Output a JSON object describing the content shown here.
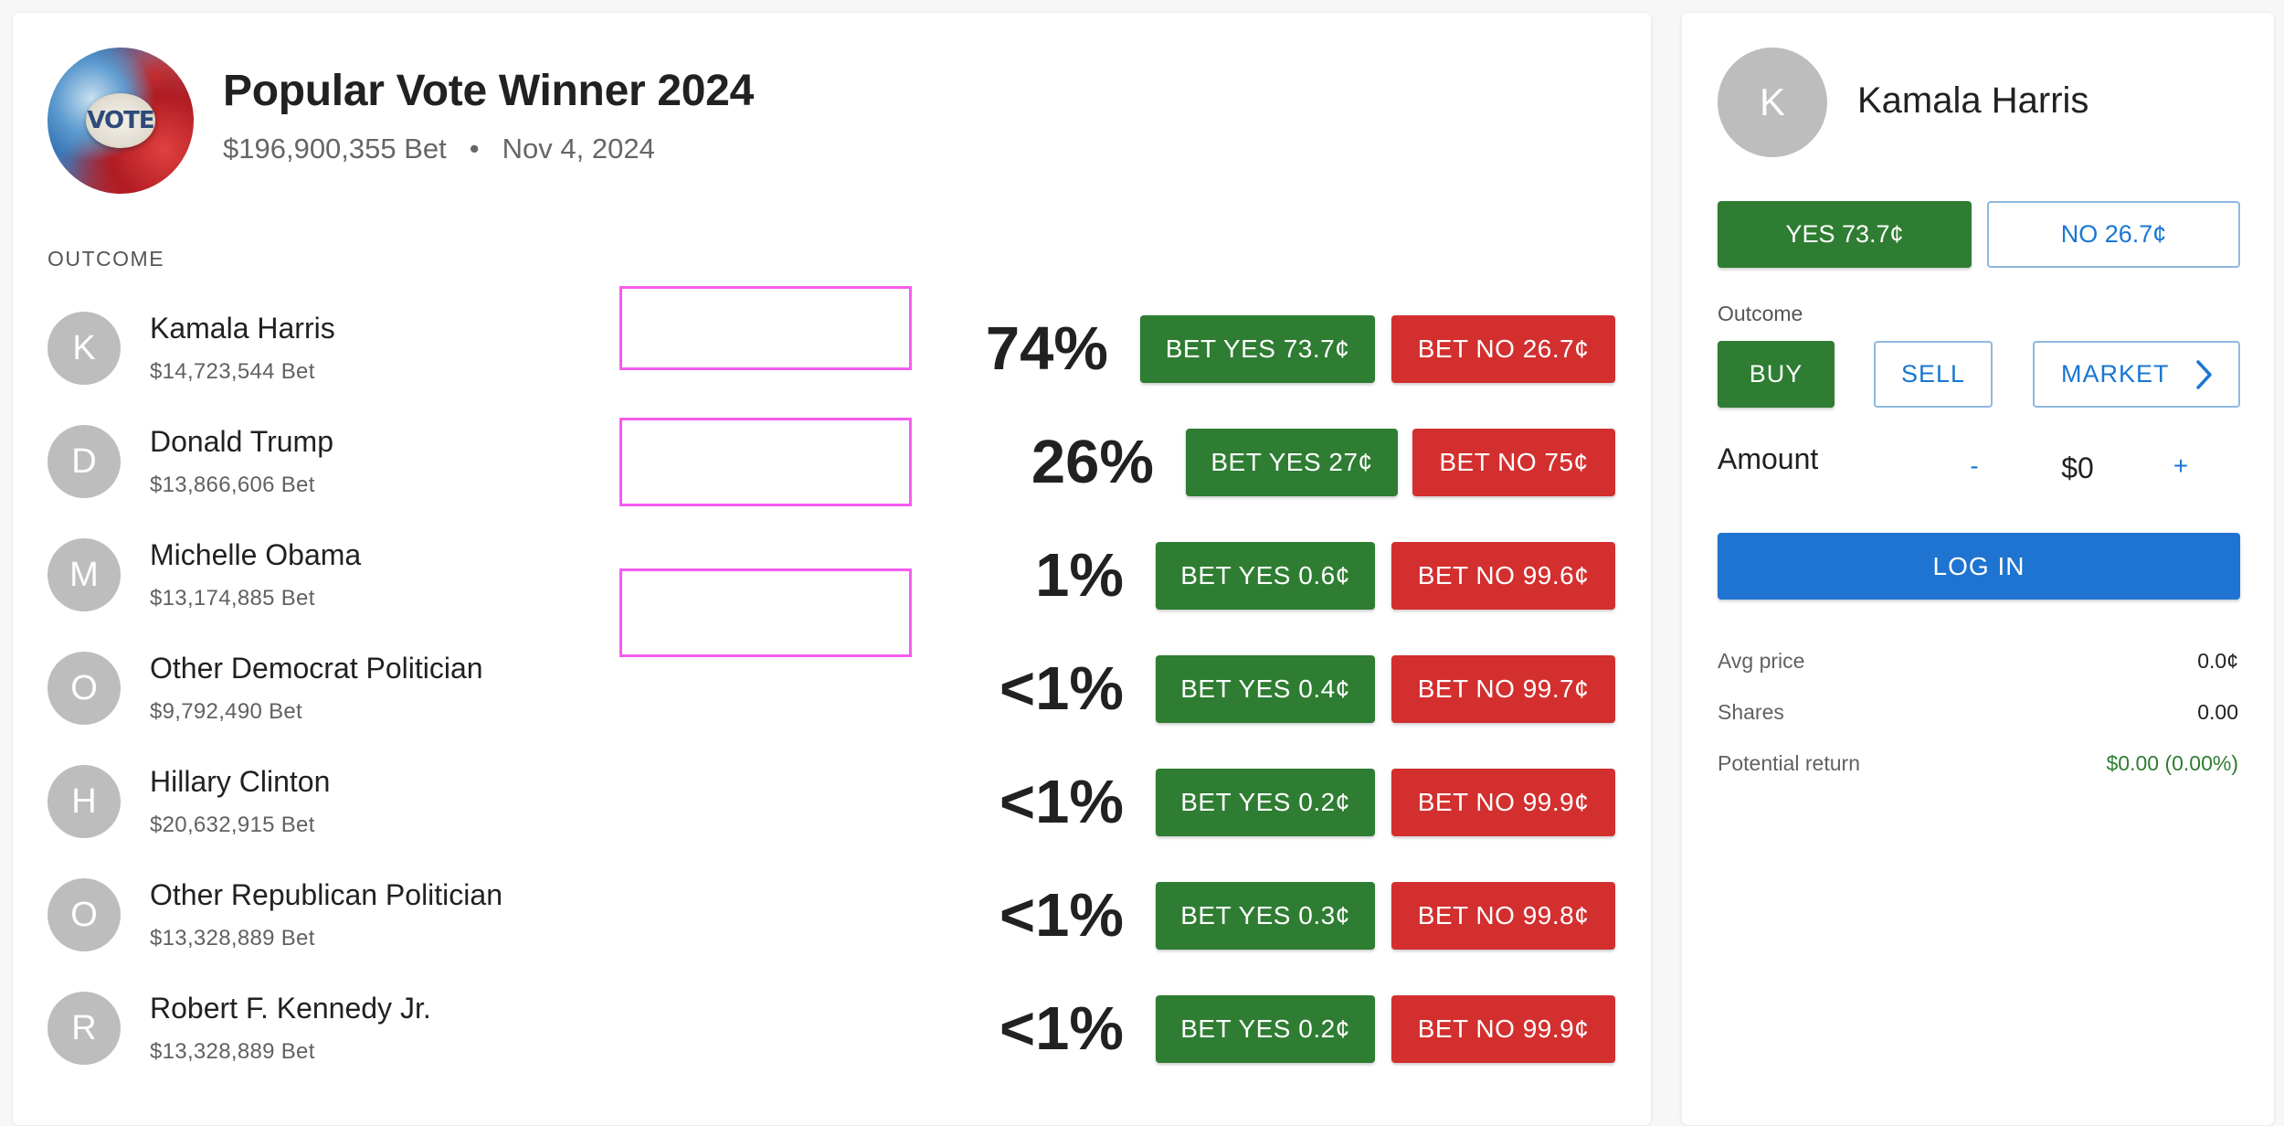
{
  "market": {
    "title": "Popular Vote Winner 2024",
    "volume": "$196,900,355 Bet",
    "separator": "•",
    "date": "Nov 4, 2024",
    "image_text": "VOTE",
    "outcome_header": "OUTCOME"
  },
  "outcomes": [
    {
      "initial": "K",
      "name": "Kamala Harris",
      "volume": "$14,723,544 Bet",
      "pct": "74%",
      "yes": "BET YES 73.7¢",
      "no": "BET NO 26.7¢"
    },
    {
      "initial": "D",
      "name": "Donald Trump",
      "volume": "$13,866,606 Bet",
      "pct": "26%",
      "yes": "BET YES 27¢",
      "no": "BET NO 75¢"
    },
    {
      "initial": "M",
      "name": "Michelle Obama",
      "volume": "$13,174,885 Bet",
      "pct": "1%",
      "yes": "BET YES 0.6¢",
      "no": "BET NO 99.6¢"
    },
    {
      "initial": "O",
      "name": "Other Democrat Politician",
      "volume": "$9,792,490 Bet",
      "pct": "<1%",
      "yes": "BET YES 0.4¢",
      "no": "BET NO 99.7¢"
    },
    {
      "initial": "H",
      "name": "Hillary Clinton",
      "volume": "$20,632,915 Bet",
      "pct": "<1%",
      "yes": "BET YES 0.2¢",
      "no": "BET NO 99.9¢"
    },
    {
      "initial": "O",
      "name": "Other Republican Politician",
      "volume": "$13,328,889 Bet",
      "pct": "<1%",
      "yes": "BET YES 0.3¢",
      "no": "BET NO 99.8¢"
    },
    {
      "initial": "R",
      "name": "Robert F. Kennedy Jr.",
      "volume": "$13,328,889 Bet",
      "pct": "<1%",
      "yes": "BET YES 0.2¢",
      "no": "BET NO 99.9¢"
    }
  ],
  "panel": {
    "initial": "K",
    "name": "Kamala Harris",
    "yes_label": "YES 73.7¢",
    "no_label": "NO 26.7¢",
    "outcome_label": "Outcome",
    "buy_label": "BUY",
    "sell_label": "SELL",
    "market_label": "MARKET",
    "amount_label": "Amount",
    "minus": "-",
    "amount_value": "$0",
    "plus": "+",
    "login_label": "LOG IN",
    "avg_price_label": "Avg price",
    "avg_price_value": "0.0¢",
    "shares_label": "Shares",
    "shares_value": "0.00",
    "return_label": "Potential return",
    "return_value": "$0.00 (0.00%)"
  },
  "colors": {
    "yes_green": "#2e7d32",
    "no_red": "#d32f2f",
    "primary_blue": "#1e74d0",
    "outline_highlight": "#f55cf0"
  }
}
